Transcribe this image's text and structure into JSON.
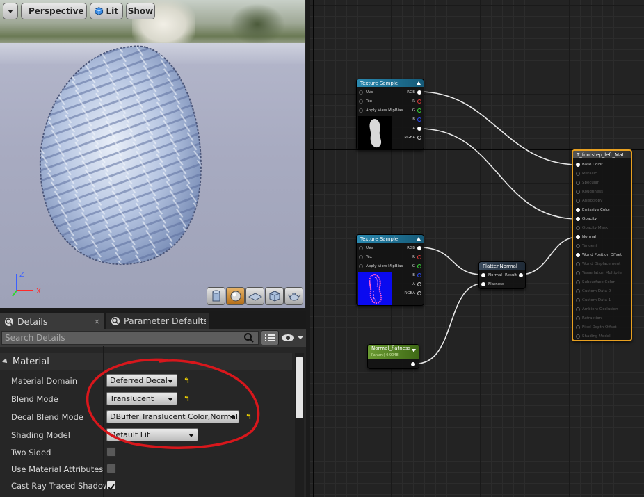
{
  "viewport": {
    "toolbar": {
      "perspective_label": "Perspective",
      "lit_label": "Lit",
      "show_label": "Show"
    },
    "axes": {
      "z": "Z",
      "x": "X"
    },
    "preview_shapes": [
      "cylinder-icon",
      "sphere-icon",
      "plane-icon",
      "cube-icon",
      "teapot-icon"
    ]
  },
  "details": {
    "tabs": [
      {
        "label": "Details",
        "close": "×"
      },
      {
        "label": "Parameter Defaults",
        "close": ""
      }
    ],
    "search": {
      "placeholder": "Search Details"
    },
    "section": {
      "label": "Material"
    },
    "properties": [
      {
        "label": "Material Domain",
        "value": "Deferred Decal"
      },
      {
        "label": "Blend Mode",
        "value": "Translucent"
      },
      {
        "label": "Decal Blend Mode",
        "value": "DBuffer Translucent Color,Normal"
      },
      {
        "label": "Shading Model",
        "value": "Default Lit"
      },
      {
        "label": "Two Sided",
        "checked": false
      },
      {
        "label": "Use Material Attributes",
        "checked": false
      },
      {
        "label": "Cast Ray Traced Shadows",
        "checked": true
      }
    ],
    "annotation_color": "#d8171c"
  },
  "graph": {
    "texture_sample_1": {
      "title": "Texture Sample",
      "inputs": [
        "UVs",
        "Tex",
        "Apply View MipBias"
      ],
      "outputs": [
        "RGB",
        "R",
        "G",
        "B",
        "A",
        "RGBA"
      ]
    },
    "texture_sample_2": {
      "title": "Texture Sample",
      "inputs": [
        "UVs",
        "Tex",
        "Apply View MipBias"
      ],
      "outputs": [
        "RGB",
        "R",
        "G",
        "B",
        "A",
        "RGBA"
      ]
    },
    "flatten_normal": {
      "title": "FlattenNormal",
      "inputs": [
        "Normal",
        "Flatness"
      ],
      "output": "Result"
    },
    "param": {
      "title": "Normal_flatness",
      "subtitle": "Param (-0.9048)"
    },
    "material": {
      "title": "T_footstep_left_Mat",
      "pins": [
        {
          "label": "Base Color",
          "active": true
        },
        {
          "label": "Metallic",
          "active": false
        },
        {
          "label": "Specular",
          "active": false
        },
        {
          "label": "Roughness",
          "active": false
        },
        {
          "label": "Anisotropy",
          "active": false
        },
        {
          "label": "Emissive Color",
          "active": true
        },
        {
          "label": "Opacity",
          "active": true
        },
        {
          "label": "Opacity Mask",
          "active": false
        },
        {
          "label": "Normal",
          "active": true
        },
        {
          "label": "Tangent",
          "active": false
        },
        {
          "label": "World Position Offset",
          "active": true
        },
        {
          "label": "World Displacement",
          "active": false
        },
        {
          "label": "Tessellation Multiplier",
          "active": false
        },
        {
          "label": "Subsurface Color",
          "active": false
        },
        {
          "label": "Custom Data 0",
          "active": false
        },
        {
          "label": "Custom Data 1",
          "active": false
        },
        {
          "label": "Ambient Occlusion",
          "active": false
        },
        {
          "label": "Refraction",
          "active": false
        },
        {
          "label": "Pixel Depth Offset",
          "active": false
        },
        {
          "label": "Shading Model",
          "active": false
        }
      ]
    },
    "colors": {
      "texture_header": "#1d6e8f",
      "param_header": "#5a8a2a",
      "material_border": "#e8a020",
      "wire": "#e8e8e8"
    }
  }
}
